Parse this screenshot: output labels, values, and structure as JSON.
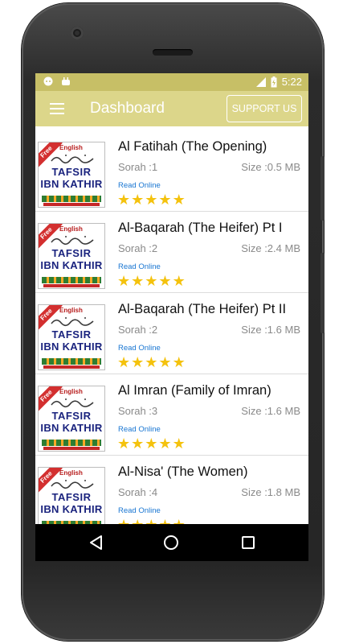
{
  "statusbar": {
    "time": "5:22"
  },
  "appbar": {
    "title": "Dashboard",
    "support_label": "SUPPORT US"
  },
  "thumb": {
    "free": "Free",
    "english": "English",
    "line1": "TAFSIR",
    "line2": "IBN KATHIR"
  },
  "items": [
    {
      "title": "Al Fatihah (The Opening)",
      "sorah": "Sorah :1",
      "size": "Size :0.5 MB",
      "read": "Read Online",
      "rating": 5
    },
    {
      "title": "Al-Baqarah (The Heifer) Pt I",
      "sorah": "Sorah :2",
      "size": "Size :2.4 MB",
      "read": "Read Online",
      "rating": 5
    },
    {
      "title": "Al-Baqarah (The Heifer) Pt II",
      "sorah": "Sorah :2",
      "size": "Size :1.6 MB",
      "read": "Read Online",
      "rating": 5
    },
    {
      "title": "Al Imran (Family of Imran)",
      "sorah": "Sorah :3",
      "size": "Size :1.6 MB",
      "read": "Read Online",
      "rating": 5
    },
    {
      "title": "Al-Nisa' (The Women)",
      "sorah": "Sorah :4",
      "size": "Size :1.8 MB",
      "read": "Read Online",
      "rating": 5
    }
  ],
  "colors": {
    "statusbar": "#c7bf66",
    "appbar": "#dcd68a",
    "star": "#f4c20d",
    "link": "#1976d2"
  },
  "icons": [
    "chat-notification-icon",
    "android-notification-icon",
    "wifi-icon",
    "battery-icon",
    "menu-icon",
    "back-icon",
    "home-icon",
    "recents-icon"
  ]
}
